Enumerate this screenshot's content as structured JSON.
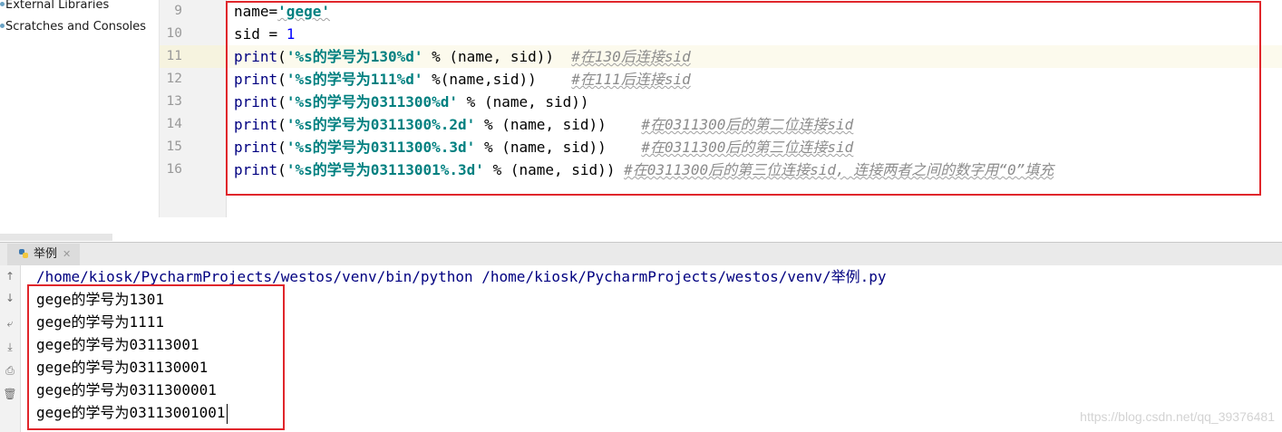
{
  "project_tree": {
    "items": [
      {
        "label": "External Libraries"
      },
      {
        "label": "Scratches and Consoles"
      }
    ]
  },
  "editor": {
    "current_line": 11,
    "lines": [
      {
        "no": "9",
        "parts": [
          {
            "t": "name=",
            "c": "plain"
          },
          {
            "t": "'gege'",
            "c": "str",
            "w": true
          }
        ]
      },
      {
        "no": "10",
        "parts": [
          {
            "t": "sid = ",
            "c": "plain"
          },
          {
            "t": "1",
            "c": "num"
          }
        ]
      },
      {
        "no": "11",
        "parts": [
          {
            "t": "print",
            "c": "kw"
          },
          {
            "t": "(",
            "c": "plain"
          },
          {
            "t": "'%s的学号为130%d'",
            "c": "str"
          },
          {
            "t": " % (name, sid))  ",
            "c": "plain"
          },
          {
            "t": "#在130后连接sid",
            "c": "cmt",
            "w": true
          }
        ]
      },
      {
        "no": "12",
        "parts": [
          {
            "t": "print",
            "c": "kw"
          },
          {
            "t": "(",
            "c": "plain"
          },
          {
            "t": "'%s的学号为111%d'",
            "c": "str"
          },
          {
            "t": " %(name,sid))    ",
            "c": "plain"
          },
          {
            "t": "#在111后连接sid",
            "c": "cmt",
            "w": true
          }
        ]
      },
      {
        "no": "13",
        "parts": [
          {
            "t": "print",
            "c": "kw"
          },
          {
            "t": "(",
            "c": "plain"
          },
          {
            "t": "'%s的学号为0311300%d'",
            "c": "str"
          },
          {
            "t": " % (name, sid))",
            "c": "plain"
          }
        ]
      },
      {
        "no": "14",
        "parts": [
          {
            "t": "print",
            "c": "kw"
          },
          {
            "t": "(",
            "c": "plain"
          },
          {
            "t": "'%s的学号为0311300%.2d'",
            "c": "str"
          },
          {
            "t": " % (name, sid))    ",
            "c": "plain"
          },
          {
            "t": "#在0311300后的第二位连接sid",
            "c": "cmt",
            "w": true
          }
        ]
      },
      {
        "no": "15",
        "parts": [
          {
            "t": "print",
            "c": "kw"
          },
          {
            "t": "(",
            "c": "plain"
          },
          {
            "t": "'%s的学号为0311300%.3d'",
            "c": "str"
          },
          {
            "t": " % (name, sid))    ",
            "c": "plain"
          },
          {
            "t": "#在0311300后的第三位连接sid",
            "c": "cmt",
            "w": true
          }
        ]
      },
      {
        "no": "16",
        "parts": [
          {
            "t": "print",
            "c": "kw"
          },
          {
            "t": "(",
            "c": "plain"
          },
          {
            "t": "'%s的学号为03113001%.3d'",
            "c": "str"
          },
          {
            "t": " % (name, sid)) ",
            "c": "plain"
          },
          {
            "t": "#在0311300后的第三位连接sid, 连接两者之间的数字用“0”填充",
            "c": "cmt",
            "w": true
          }
        ]
      }
    ]
  },
  "run": {
    "tab_label": "举例",
    "command": "/home/kiosk/PycharmProjects/westos/venv/bin/python /home/kiosk/PycharmProjects/westos/venv/举例.py",
    "output": [
      "gege的学号为1301",
      "gege的学号为1111",
      "gege的学号为03113001",
      "gege的学号为031130001",
      "gege的学号为0311300001",
      "gege的学号为03113001001"
    ],
    "toolbar": [
      {
        "icon": "arrow-up-icon",
        "glyph": "↑"
      },
      {
        "icon": "arrow-down-icon",
        "glyph": "↓"
      },
      {
        "icon": "soft-wrap-icon",
        "glyph": "⤶"
      },
      {
        "icon": "scroll-to-end-icon",
        "glyph": "⤓"
      },
      {
        "icon": "print-icon",
        "glyph": "⎙"
      },
      {
        "icon": "trash-icon",
        "glyph": "🗑"
      }
    ]
  },
  "watermark": "https://blog.csdn.net/qq_39376481",
  "colors": {
    "highlight_box": "#e0262b",
    "keyword": "#000080",
    "string": "#008080",
    "number": "#0000ff",
    "comment": "#8c8c8c"
  }
}
